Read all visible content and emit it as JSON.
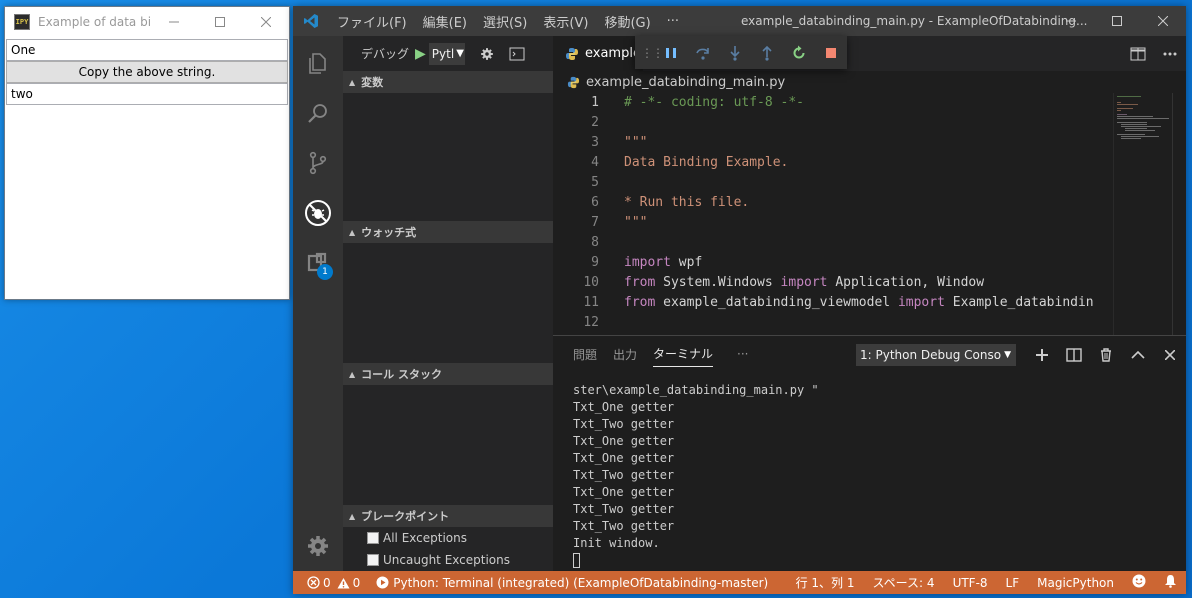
{
  "wpf_window": {
    "title": "Example of data bin...",
    "icon_text": "IPY",
    "textbox_one": "One",
    "copy_button": "Copy the above string.",
    "textbox_two": "two"
  },
  "vscode": {
    "menu": [
      "ファイル(F)",
      "編集(E)",
      "選択(S)",
      "表示(V)",
      "移動(G)",
      "···"
    ],
    "window_title": "example_databinding_main.py - ExampleOfDatabinding...",
    "activity_badge": "1",
    "sidebar": {
      "debug_label": "デバッグ",
      "config_select": "Pytl",
      "sections": {
        "variables": "変数",
        "watch": "ウォッチ式",
        "callstack": "コール スタック",
        "breakpoints": "ブレークポイント"
      },
      "breakpoints": [
        "All Exceptions",
        "Uncaught Exceptions"
      ]
    },
    "editor": {
      "tab_label": "example",
      "breadcrumb": "example_databinding_main.py",
      "current_line": 1,
      "lines": [
        {
          "n": "1",
          "parts": [
            {
              "t": "# -*- coding: utf-8 -*-",
              "c": "c-comment"
            }
          ]
        },
        {
          "n": "2",
          "parts": []
        },
        {
          "n": "3",
          "parts": [
            {
              "t": "\"\"\"",
              "c": "c-string"
            }
          ]
        },
        {
          "n": "4",
          "parts": [
            {
              "t": "Data Binding Example.",
              "c": "c-string"
            }
          ]
        },
        {
          "n": "5",
          "parts": []
        },
        {
          "n": "6",
          "parts": [
            {
              "t": "* Run this file.",
              "c": "c-string"
            }
          ]
        },
        {
          "n": "7",
          "parts": [
            {
              "t": "\"\"\"",
              "c": "c-string"
            }
          ]
        },
        {
          "n": "8",
          "parts": []
        },
        {
          "n": "9",
          "parts": [
            {
              "t": "import",
              "c": "c-kw"
            },
            {
              "t": " wpf",
              "c": "c-plain"
            }
          ]
        },
        {
          "n": "10",
          "parts": [
            {
              "t": "from",
              "c": "c-kw"
            },
            {
              "t": " System.Windows ",
              "c": "c-plain"
            },
            {
              "t": "import",
              "c": "c-kw"
            },
            {
              "t": " Application, Window",
              "c": "c-plain"
            }
          ]
        },
        {
          "n": "11",
          "parts": [
            {
              "t": "from",
              "c": "c-kw"
            },
            {
              "t": " example_databinding_viewmodel ",
              "c": "c-plain"
            },
            {
              "t": "import",
              "c": "c-kw"
            },
            {
              "t": " Example_databindin",
              "c": "c-plain"
            }
          ]
        },
        {
          "n": "12",
          "parts": []
        }
      ]
    },
    "panel": {
      "tabs": [
        "問題",
        "出力",
        "ターミナル",
        "···"
      ],
      "active_tab": "ターミナル",
      "terminal_select": "1: Python Debug Conso",
      "terminal_lines": [
        "ster\\example_databinding_main.py \"",
        "Txt_One getter",
        "Txt_Two getter",
        "Txt_One getter",
        "Txt_One getter",
        "Txt_Two getter",
        "Txt_One getter",
        "Txt_Two getter",
        "Txt_Two getter",
        "Init window."
      ]
    },
    "statusbar": {
      "errors": "0",
      "warnings": "0",
      "debug_target": "Python: Terminal (integrated) (ExampleOfDatabinding-master)",
      "position": "行 1、列 1",
      "spaces": "スペース: 4",
      "encoding": "UTF-8",
      "eol": "LF",
      "language": "MagicPython"
    },
    "colors": {
      "statusbar_debug": "#cc6633",
      "activity_bar": "#333333",
      "editor_bg": "#1e1e1e",
      "accent": "#007acc"
    }
  }
}
